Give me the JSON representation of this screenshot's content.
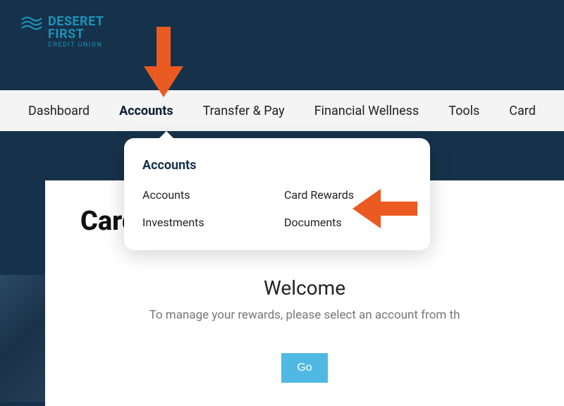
{
  "brand": {
    "line1": "DESERET",
    "line2": "FIRST",
    "tagline": "CREDIT UNION"
  },
  "nav": {
    "items": [
      {
        "label": "Dashboard",
        "active": false
      },
      {
        "label": "Accounts",
        "active": true
      },
      {
        "label": "Transfer & Pay",
        "active": false
      },
      {
        "label": "Financial Wellness",
        "active": false
      },
      {
        "label": "Tools",
        "active": false
      },
      {
        "label": "Card",
        "active": false
      }
    ]
  },
  "dropdown": {
    "title": "Accounts",
    "items": [
      "Accounts",
      "Card Rewards",
      "Investments",
      "Documents"
    ]
  },
  "page": {
    "title": "Card"
  },
  "welcome": {
    "heading": "Welcome",
    "message": "To manage your rewards, please select an account from th",
    "button": "Go"
  },
  "colors": {
    "brand_navy": "#16324a",
    "brand_teal": "#1a92b8",
    "accent_orange": "#ea5a21",
    "button_blue": "#4fb9e3"
  }
}
